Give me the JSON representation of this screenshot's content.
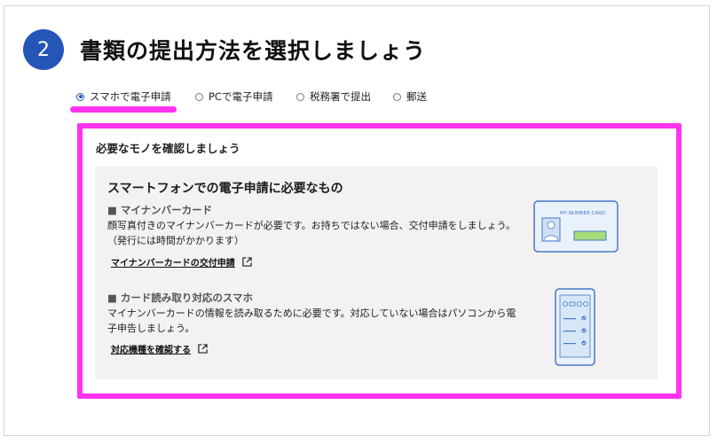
{
  "step": {
    "number": "2",
    "title": "書類の提出方法を選択しましょう"
  },
  "tabs": [
    {
      "label": "スマホで電子申請",
      "selected": true
    },
    {
      "label": "PCで電子申請",
      "selected": false
    },
    {
      "label": "税務署で提出",
      "selected": false
    },
    {
      "label": "郵送",
      "selected": false
    }
  ],
  "card": {
    "heading": "必要なモノを確認しましょう",
    "panel_title": "スマートフォンでの電子申請に必要なもの",
    "items": [
      {
        "head": "■ マイナンバーカード",
        "desc": "顔写真付きのマイナンバーカードが必要です。お持ちではない場合、交付申請をしましょう。（発行には時間がかかります）",
        "link": "マイナンバーカードの交付申請",
        "illustration": "my-number-card-icon",
        "illustration_text": "MY NUMBER CARD"
      },
      {
        "head": "■ カード読み取り対応のスマホ",
        "desc": "マイナンバーカードの情報を読み取るために必要です。対応していない場合はパソコンから電子申告しましょう。",
        "link": "対応機種を確認する",
        "illustration": "smartphone-icon"
      }
    ]
  },
  "colors": {
    "accent": "#2456b8",
    "highlight": "#ff33ee",
    "panel_bg": "#f3f1f1",
    "illustration_blue": "#4a78c8"
  }
}
